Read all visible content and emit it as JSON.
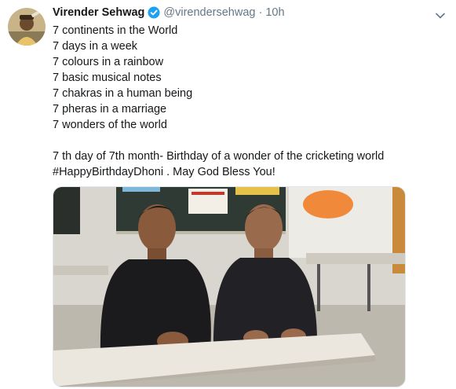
{
  "tweet": {
    "display_name": "Virender Sehwag",
    "handle": "@virendersehwag",
    "separator": "·",
    "time": "10h",
    "verified": true,
    "lines": [
      "7 continents in the World",
      "7 days in a week",
      "7 colours in a rainbow",
      "7 basic musical notes",
      "7 chakras in a human being",
      "7 pheras in a marriage",
      "7 wonders of the world"
    ],
    "closing_line": "7 th day of 7th month- Birthday of a wonder of the cricketing world",
    "hashtag": "#HappyBirthdayDhoni",
    "closing_suffix": " . May God Bless You!"
  },
  "icons": {
    "verified": "verified-badge-icon",
    "menu": "chevron-down-icon"
  },
  "colors": {
    "text": "#14171a",
    "secondary": "#657786",
    "verified_blue": "#1da1f2",
    "border": "#e1e8ed"
  }
}
